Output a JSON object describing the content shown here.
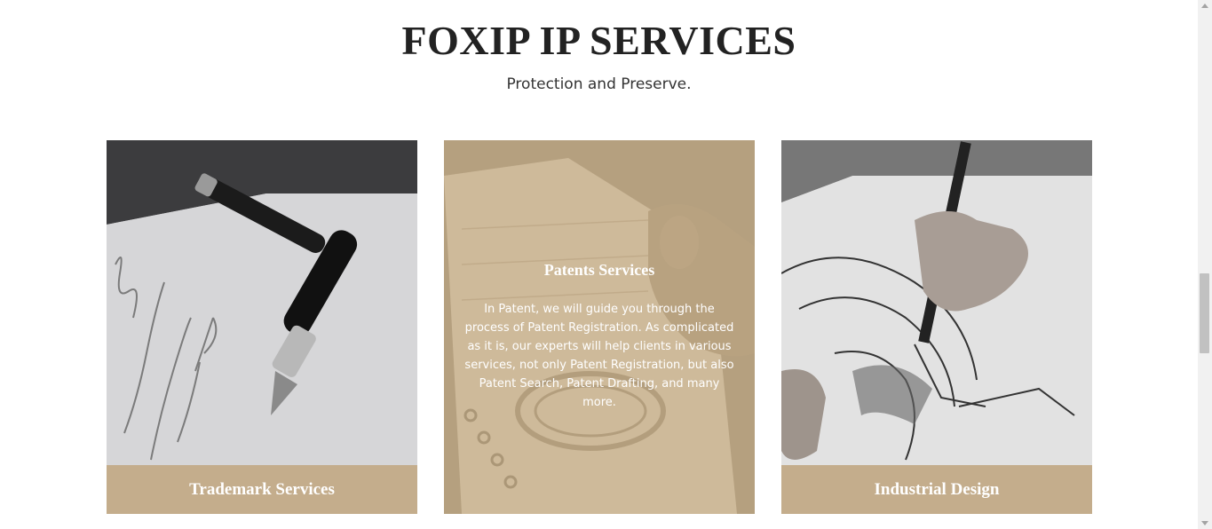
{
  "header": {
    "title": "FOXIP IP SERVICES",
    "subtitle": "Protection and Preserve."
  },
  "cards": [
    {
      "label": "Trademark Services",
      "image": "pen-on-paper-photo"
    },
    {
      "label": "Patents Services",
      "image": "patent-notebook-photo",
      "overlay_title": "Patents Services",
      "overlay_description": "In Patent, we will guide you through the process of Patent Registration. As complicated as it is, our experts will help clients in various services, not only Patent Registration, but also Patent Search, Patent Drafting, and many more."
    },
    {
      "label": "Industrial Design",
      "image": "design-sketch-photo"
    }
  ],
  "colors": {
    "accent": "#c4ad8c",
    "title": "#222222"
  }
}
